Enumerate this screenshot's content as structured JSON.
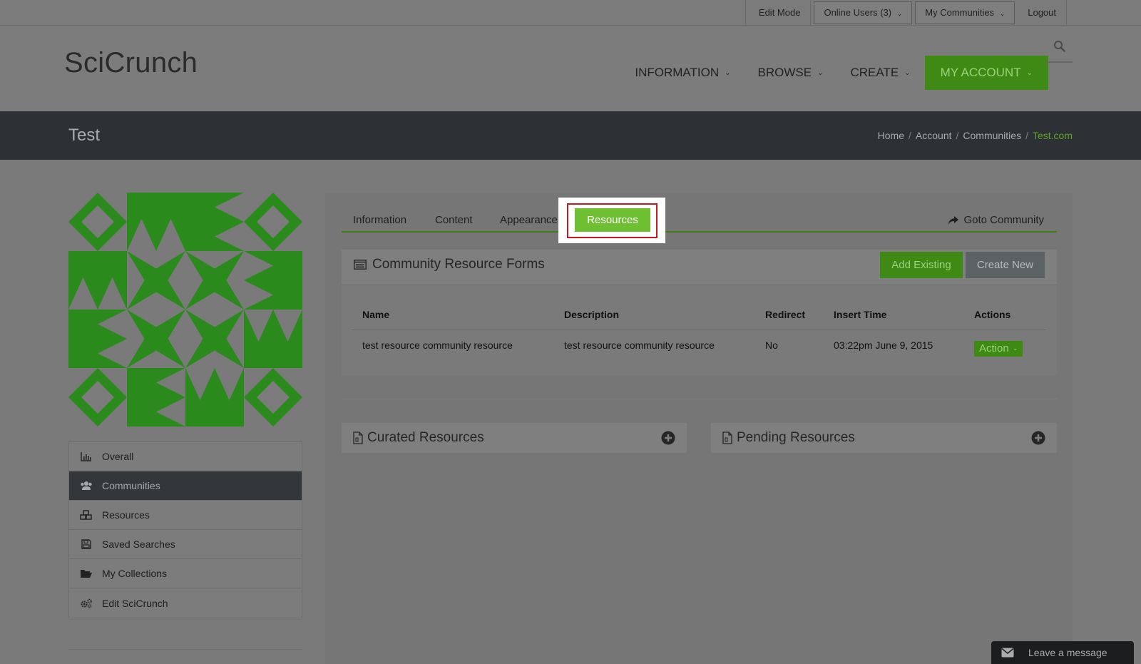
{
  "topbar": {
    "edit_mode": "Edit Mode",
    "online_users": "Online Users (3)",
    "my_communities": "My Communities",
    "logout": "Logout"
  },
  "header": {
    "logo": "SciCrunch",
    "nav": [
      "INFORMATION",
      "BROWSE",
      "CREATE"
    ],
    "my_account": "MY ACCOUNT"
  },
  "titlebar": {
    "title": "Test",
    "breadcrumb": [
      "Home",
      "Account",
      "Communities"
    ],
    "breadcrumb_current": "Test.com"
  },
  "sidebar": {
    "items": [
      {
        "label": "Overall",
        "icon": "bar-chart-icon"
      },
      {
        "label": "Communities",
        "icon": "users-icon"
      },
      {
        "label": "Resources",
        "icon": "cubes-icon"
      },
      {
        "label": "Saved Searches",
        "icon": "floppy-disk-icon"
      },
      {
        "label": "My Collections",
        "icon": "folder-open-icon"
      },
      {
        "label": "Edit SciCrunch",
        "icon": "gears-icon"
      }
    ],
    "active_index": 1
  },
  "tabs": {
    "items": [
      "Information",
      "Content",
      "Appearance"
    ],
    "active": "Resources",
    "goto": "Goto Community"
  },
  "forms": {
    "title": "Community Resource Forms",
    "add_existing": "Add Existing",
    "create_new": "Create New",
    "columns": [
      "Name",
      "Description",
      "Redirect",
      "Insert Time",
      "Actions"
    ],
    "rows": [
      {
        "name": "test resource community resource",
        "description": "test resource community resource",
        "redirect": "No",
        "insert_time": "03:22pm June 9, 2015",
        "action": "Action"
      }
    ]
  },
  "cards": {
    "curated": "Curated Resources",
    "pending": "Pending Resources"
  },
  "chat": {
    "label": "Leave a message"
  },
  "colors": {
    "accent_green": "#3e8a15",
    "active_tab": "#6fbf33",
    "highlight_border": "#c8191f",
    "dark_bar": "#2d3135"
  }
}
